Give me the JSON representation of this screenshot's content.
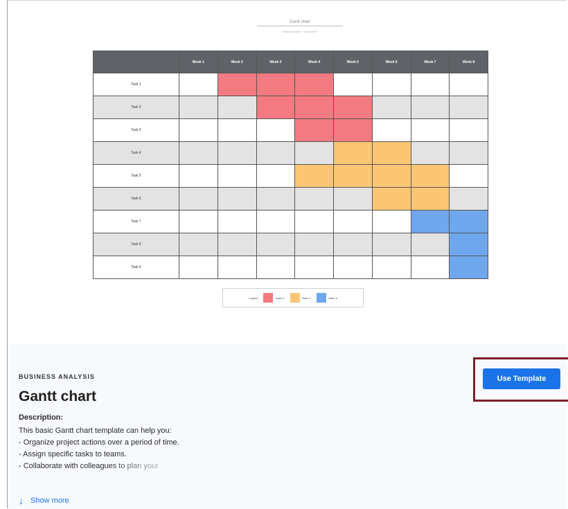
{
  "preview": {
    "chart_title": "Gantt chart",
    "chart_subtitle": "Basic template · Gantt chart",
    "weeks": [
      "Week 1",
      "Week 2",
      "Week 3",
      "Week 4",
      "Week 5",
      "Week 6",
      "Week 7",
      "Week 8"
    ],
    "tasks": [
      "Task 1",
      "Task 2",
      "Task 3",
      "Task 4",
      "Task 5",
      "Task 6",
      "Task 7",
      "Task 8",
      "Task 9"
    ],
    "bars": [
      {
        "start": 1,
        "end": 3,
        "color": "red"
      },
      {
        "start": 2,
        "end": 4,
        "color": "red"
      },
      {
        "start": 3,
        "end": 4,
        "color": "red"
      },
      {
        "start": 4,
        "end": 5,
        "color": "orange"
      },
      {
        "start": 3,
        "end": 6,
        "color": "orange"
      },
      {
        "start": 5,
        "end": 6,
        "color": "orange"
      },
      {
        "start": 6,
        "end": 7,
        "color": "blue"
      },
      {
        "start": 7,
        "end": 7,
        "color": "blue"
      },
      {
        "start": 7,
        "end": 8,
        "color": "blue"
      }
    ],
    "colors": {
      "red": "#f27a80",
      "orange": "#fbc673",
      "blue": "#6ea7ee",
      "header": "#5f6368"
    },
    "legend": {
      "label": "Legend",
      "items": [
        {
          "label": "Team 1",
          "color": "red"
        },
        {
          "label": "Team 2",
          "color": "orange"
        },
        {
          "label": "Team 3",
          "color": "blue"
        }
      ]
    }
  },
  "info": {
    "category": "BUSINESS ANALYSIS",
    "title": "Gantt chart",
    "description_label": "Description:",
    "description_lines": [
      "This basic Gantt chart template can help you:",
      "- Organize project actions over a period of time.",
      "- Assign specific tasks to teams.",
      "- Collaborate with colleagues to plan your"
    ],
    "show_more": "Show more",
    "use_template": "Use Template"
  }
}
